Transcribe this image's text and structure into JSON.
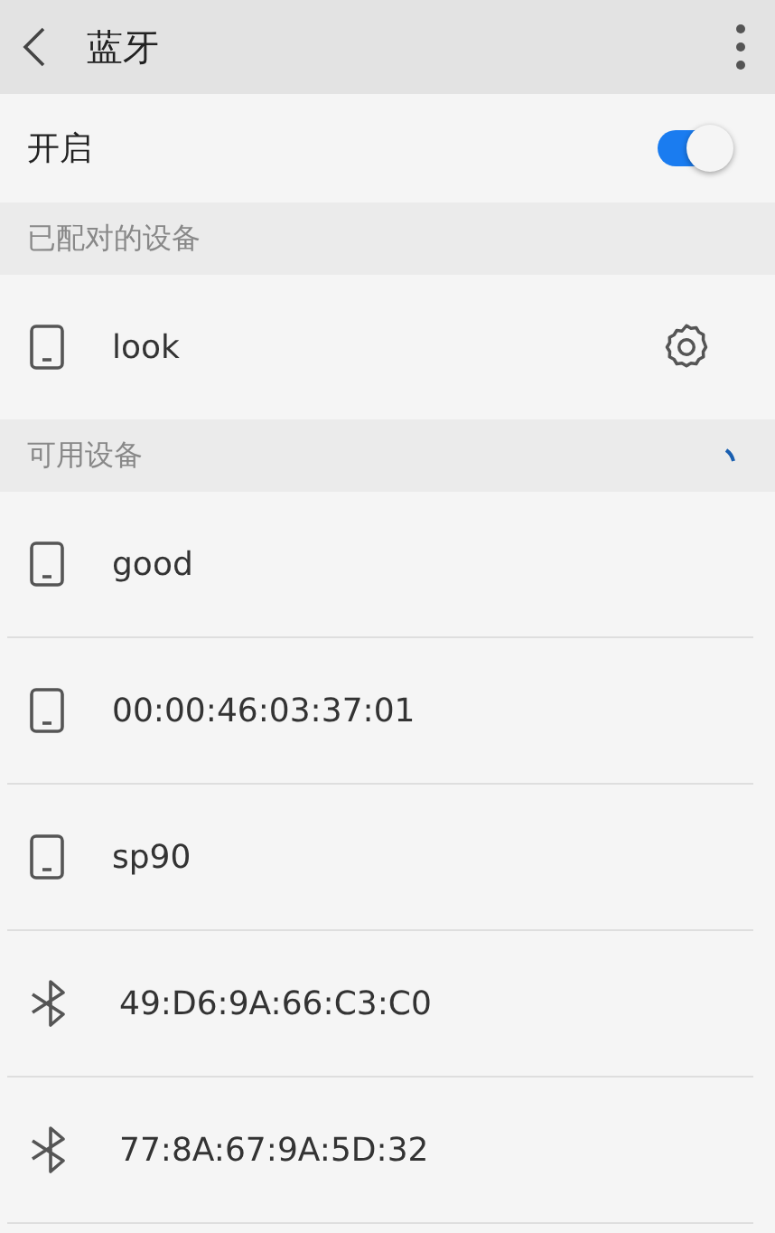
{
  "header": {
    "title": "蓝牙"
  },
  "toggle": {
    "label": "开启",
    "on": true
  },
  "paired": {
    "title": "已配对的设备",
    "devices": [
      {
        "name": "look",
        "kind": "phone"
      }
    ]
  },
  "available": {
    "title": "可用设备",
    "devices": [
      {
        "name": "good",
        "kind": "phone"
      },
      {
        "name": "00:00:46:03:37:01",
        "kind": "phone"
      },
      {
        "name": "sp90",
        "kind": "phone"
      },
      {
        "name": "49:D6:9A:66:C3:C0",
        "kind": "bluetooth"
      },
      {
        "name": "77:8A:67:9A:5D:32",
        "kind": "bluetooth"
      }
    ]
  }
}
